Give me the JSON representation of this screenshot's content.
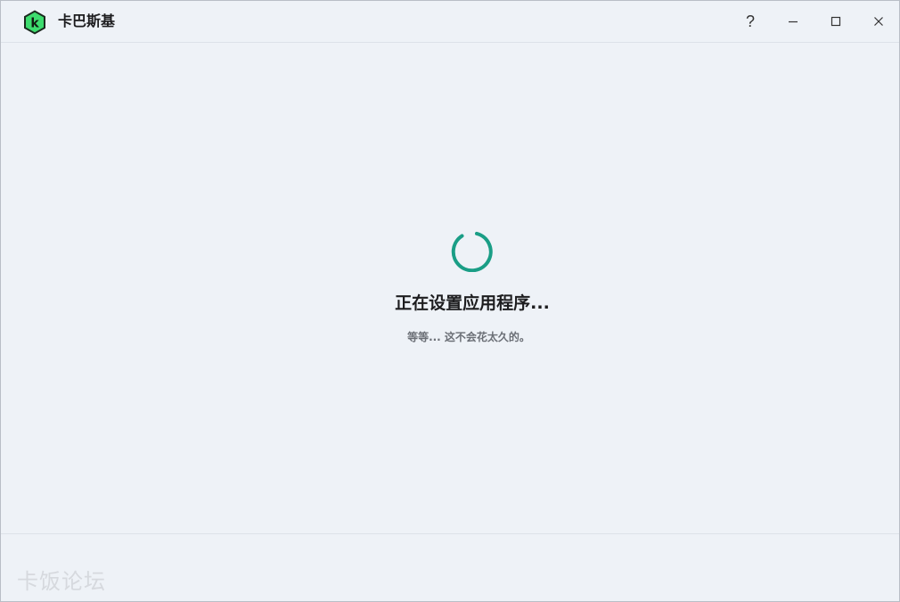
{
  "window": {
    "title": "卡巴斯基",
    "controls": {
      "help": "?",
      "minimize": "minimize-icon",
      "maximize": "maximize-icon",
      "close": "close-icon"
    }
  },
  "main": {
    "status_title": "正在设置应用程序...",
    "status_subtitle": "等等... 这不会花太久的。",
    "spinner_color": "#1a9e86"
  },
  "footer": {
    "watermark": "卡饭论坛"
  },
  "colors": {
    "background": "#eef2f7",
    "logo_green": "#3ddc6e",
    "logo_dark": "#0f1a12",
    "accent": "#1a9e86"
  }
}
